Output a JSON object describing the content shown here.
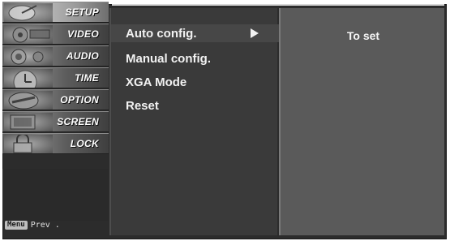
{
  "sidebar": {
    "items": [
      {
        "label": "SETUP",
        "icon": "satellite-dish-icon",
        "active": true
      },
      {
        "label": "VIDEO",
        "icon": "film-reel-icon",
        "active": false
      },
      {
        "label": "AUDIO",
        "icon": "speaker-icon",
        "active": false
      },
      {
        "label": "TIME",
        "icon": "clock-icon",
        "active": false
      },
      {
        "label": "OPTION",
        "icon": "option-badge-icon",
        "active": false
      },
      {
        "label": "SCREEN",
        "icon": "screen-icon",
        "active": false
      },
      {
        "label": "LOCK",
        "icon": "lock-icon",
        "active": false
      }
    ]
  },
  "footer": {
    "menu_key": "Menu",
    "prev_label": "Prev ."
  },
  "submenu": {
    "items": [
      {
        "label": "Auto config.",
        "selected": true
      },
      {
        "label": "Manual config.",
        "selected": false
      },
      {
        "label": "XGA Mode",
        "selected": false
      },
      {
        "label": "Reset",
        "selected": false
      }
    ]
  },
  "right_panel": {
    "text": "To set"
  },
  "colors": {
    "background": "#2c2c2c",
    "menu_column": "#3a3a3a",
    "right_panel": "#5a5a5a",
    "text": "#f2f2f2"
  }
}
